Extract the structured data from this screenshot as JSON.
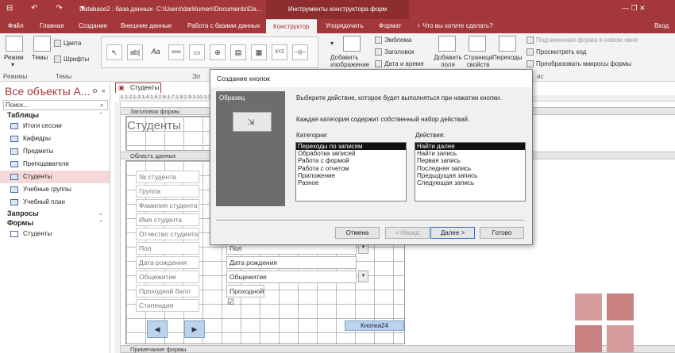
{
  "titlebar": {
    "qat": "⊟ ↶ ↷ ▾",
    "doc_title": "Database2 : база данных- C:\\Users\\darklumen\\Documents\\Da...",
    "ctx_title": "Инструменты конструктора форм",
    "controls": "—   ❐   ✕"
  },
  "tabs": [
    "Файл",
    "Главная",
    "Создание",
    "Внешние данные",
    "Работа с базами данных",
    "Конструктор",
    "Упорядочить",
    "Формат",
    "♀ Что вы хотите сделать?",
    "Вход"
  ],
  "ribbon": {
    "mode_label": "Режим",
    "themes_label": "Темы",
    "colors_label": "Цвета",
    "fonts_label": "Шрифты",
    "group_modes": "Режимы",
    "group_themes": "Темы",
    "group_control": "Эл",
    "controls": [
      "↖",
      "ab|",
      "Aa",
      "xxxx",
      "▭",
      "⊕",
      "▤",
      "▦",
      "XYZ",
      "⊣⊢"
    ],
    "logo_label": "Эмблема",
    "header_label": "Заголовок",
    "datetime_label": "Дата и время",
    "add_image_label": "Добавить изображение",
    "add_fields_label": "Добавить поля",
    "prop_page_label": "Страница свойств",
    "tab_order_label": "Переходы",
    "subform_label": "Подчиненная форма в новом окне",
    "view_code_label": "Просмотреть код",
    "convert_macros_label": "Преобразовать макросы формы",
    "group_tools": "ис"
  },
  "nav": {
    "title": "Все объекты А...",
    "search_placeholder": "Поиск...",
    "sec_tables": "Таблицы",
    "tables": [
      "Итоги сессии",
      "Кафедры",
      "Предметы",
      "Преподаватели",
      "Студенты",
      "Учебные группы",
      "Учебный план"
    ],
    "sec_queries": "Запросы",
    "sec_forms": "Формы",
    "forms": [
      "Студенты"
    ]
  },
  "doc": {
    "tab_label": "Студенты",
    "ruler": "·1·1·2·1·3·1·4·1·5·1·6·1·7·1·8·1·9·1·10·1·11·1·12·1·13·1·14·1·15·1·16·1·17·1·18·1·19·1·20·1·21·1·22·1·23·1·24·1·25·1·26·1·27",
    "header_section": "Заголовок формы",
    "detail_section": "Область данных",
    "footer_section": "Примечание формы",
    "form_title": "Студенты",
    "fields": [
      "№ студента",
      "Группа",
      "Фамилия студента",
      "Имя студента",
      "Отчество студента",
      "Пол",
      "Дата рождения",
      "Общежитие",
      "Проходной балл",
      "Стипендия"
    ],
    "controls": {
      "pol": "Пол",
      "dob": "Дата рождения",
      "dorm": "Общежитие",
      "score": "Проходной"
    },
    "checkbox": "☑",
    "prev_btn": "◀",
    "next_btn": "▶",
    "button24": "Кнопка24"
  },
  "dialog": {
    "title": "Создание кнопок",
    "sample_label": "Образец",
    "instruction": "Выберите действие, которое будет выполняться при нажатии кнопки.",
    "note": "Каждая категория содержит собственный набор действий.",
    "categories_label": "Категории:",
    "actions_label": "Действия:",
    "categories": [
      "Переходы по записям",
      "Обработка записей",
      "Работа с формой",
      "Работа с отчетом",
      "Приложение",
      "Разное"
    ],
    "actions": [
      "Найти далее",
      "Найти запись",
      "Первая запись",
      "Последняя запись",
      "Предыдущая запись",
      "Следующая запись"
    ],
    "btn_cancel": "Отмена",
    "btn_back": "< Назад",
    "btn_next": "Далее >",
    "btn_finish": "Готово"
  }
}
